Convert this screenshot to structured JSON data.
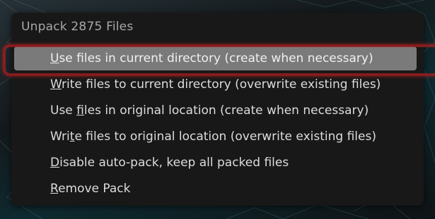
{
  "popup": {
    "title": "Unpack 2875 Files",
    "items": [
      {
        "pre": "",
        "ul": "U",
        "post": "se files in current directory (create when necessary)",
        "active": true
      },
      {
        "pre": "",
        "ul": "W",
        "post": "rite files to current directory (overwrite existing files)",
        "active": false
      },
      {
        "pre": "Use ",
        "ul": "f",
        "post": "iles in original location (create when necessary)",
        "active": false
      },
      {
        "pre": "Wri",
        "ul": "t",
        "post": "e files to original location (overwrite existing files)",
        "active": false
      },
      {
        "pre": "",
        "ul": "D",
        "post": "isable auto-pack, keep all packed files",
        "active": false
      },
      {
        "pre": "",
        "ul": "R",
        "post": "emove Pack",
        "active": false
      }
    ]
  },
  "colors": {
    "popup_bg": "#181818",
    "active_item_bg": "#7a7a7a",
    "highlight_ring": "#aa1e1e",
    "text": "#dcdcdc",
    "title_text": "#a8a8a8"
  }
}
